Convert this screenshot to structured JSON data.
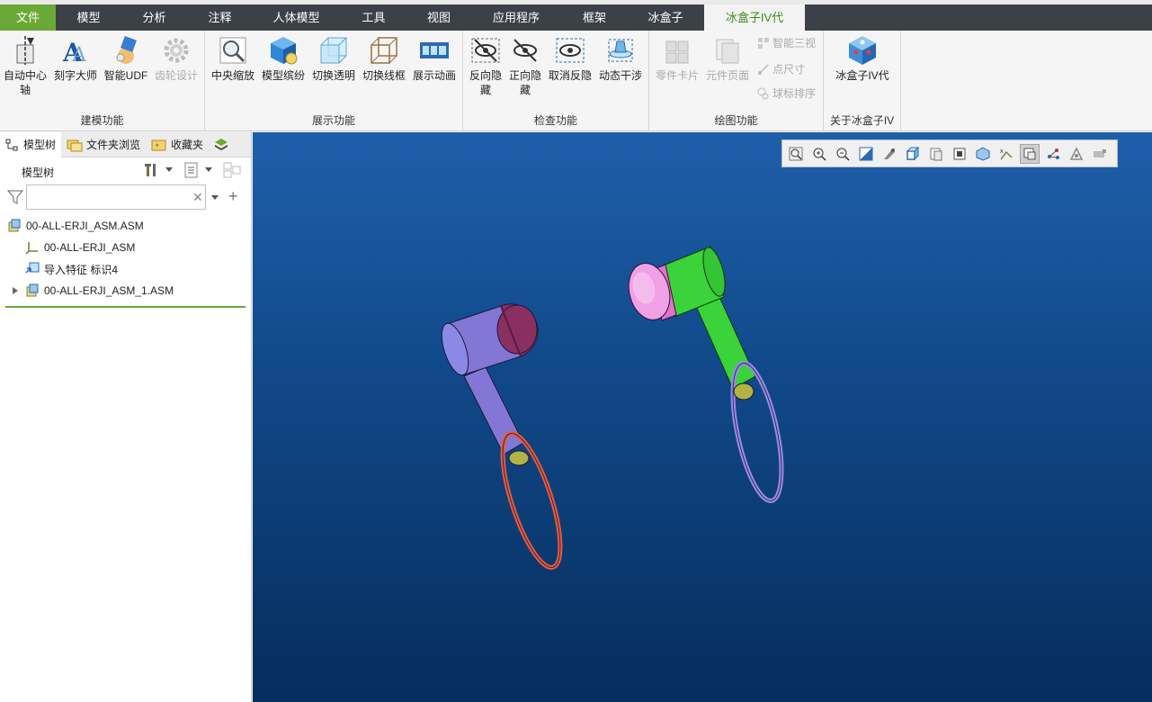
{
  "menu": {
    "items": [
      "文件",
      "模型",
      "分析",
      "注释",
      "人体模型",
      "工具",
      "视图",
      "应用程序",
      "框架",
      "冰盒子",
      "冰盒子IV代"
    ]
  },
  "ribbon": {
    "groups": {
      "modeling": {
        "label": "建模功能",
        "buttons": [
          "自动中心轴",
          "刻字大师",
          "智能UDF",
          "齿轮设计"
        ]
      },
      "display": {
        "label": "展示功能",
        "buttons": [
          "中央缩放",
          "模型缤纷",
          "切换透明",
          "切换线框",
          "展示动画"
        ]
      },
      "inspect": {
        "label": "检查功能",
        "buttons": [
          "反向隐藏",
          "正向隐藏",
          "取消反隐",
          "动态干涉"
        ]
      },
      "drawing": {
        "label": "绘图功能",
        "buttons": [
          "零件卡片",
          "元件页面"
        ],
        "small_buttons": [
          "智能三视",
          "点尺寸",
          "球标排序"
        ]
      },
      "about": {
        "label": "关于冰盒子IV",
        "buttons": [
          "冰盒子IV代"
        ]
      }
    }
  },
  "panel": {
    "tabs": [
      "模型树",
      "文件夹浏览",
      "收藏夹"
    ],
    "tree_title": "模型树",
    "filter_placeholder": "",
    "tree": [
      {
        "label": "00-ALL-ERJI_ASM.ASM",
        "icon": "assembly-icon"
      },
      {
        "label": "00-ALL-ERJI_ASM",
        "icon": "csys-icon"
      },
      {
        "label": "导入特征 标识4",
        "icon": "import-feature-icon"
      },
      {
        "label": "00-ALL-ERJI_ASM_1.ASM",
        "icon": "assembly-icon"
      }
    ]
  },
  "viewport_toolbar": [
    "refit",
    "zoom-in",
    "zoom-out",
    "repaint",
    "saved-orientations",
    "view-manager",
    "display-style",
    "perspective",
    "spin-center",
    "annotation-display",
    "plane-display",
    "csys-display",
    "point-display",
    "axis-display"
  ],
  "colors": {
    "accent_green": "#6aa935",
    "menubar_bg": "#3c4147",
    "viewport_top": "#1f5faa",
    "viewport_bottom": "#062d5c"
  }
}
